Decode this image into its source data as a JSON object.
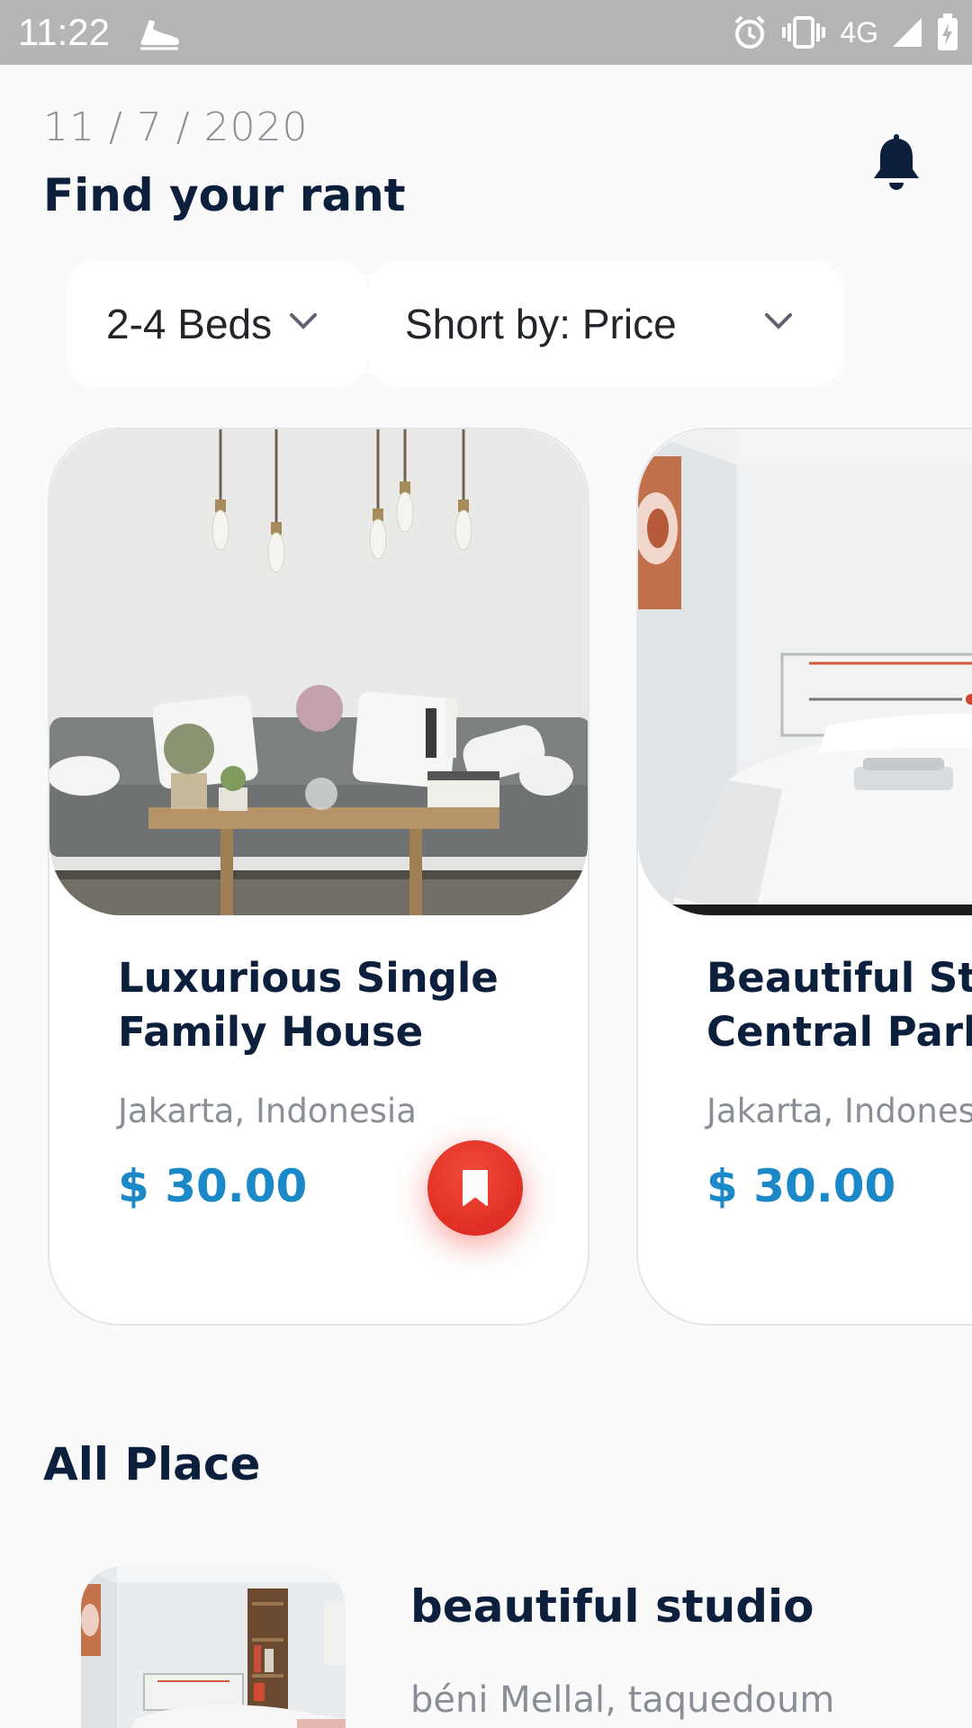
{
  "status_bar": {
    "time": "11:22",
    "network": "4G",
    "icons": [
      "shoe-icon",
      "alarm-icon",
      "vibrate-icon",
      "signal-icon",
      "battery-charging-icon"
    ]
  },
  "header": {
    "date": "11 / 7 / 2020",
    "title": "Find your rant",
    "notification_icon": "bell-icon"
  },
  "filters": {
    "beds": "2-4 Beds",
    "sort": "Short by: Price"
  },
  "featured": [
    {
      "title_line1": "Luxurious Single",
      "title_line2": "Family House",
      "location": "Jakarta, Indonesia",
      "price": "$ 30.00",
      "photo": "living-room-photo"
    },
    {
      "title_line1": "Beautiful Stud",
      "title_line2": "Central Park I",
      "location": "Jakarta, Indones",
      "price": "$ 30.00",
      "photo": "bedroom-photo"
    }
  ],
  "all_place": {
    "title": "All Place",
    "items": [
      {
        "name": "beautiful studio",
        "location": "béni Mellal, taquedoum",
        "photo": "studio-photo"
      }
    ]
  },
  "colors": {
    "primary_text": "#0c1f3d",
    "price": "#1b88c8",
    "accent_red": "#e0271f",
    "status_bar": "#b5b5b5"
  }
}
